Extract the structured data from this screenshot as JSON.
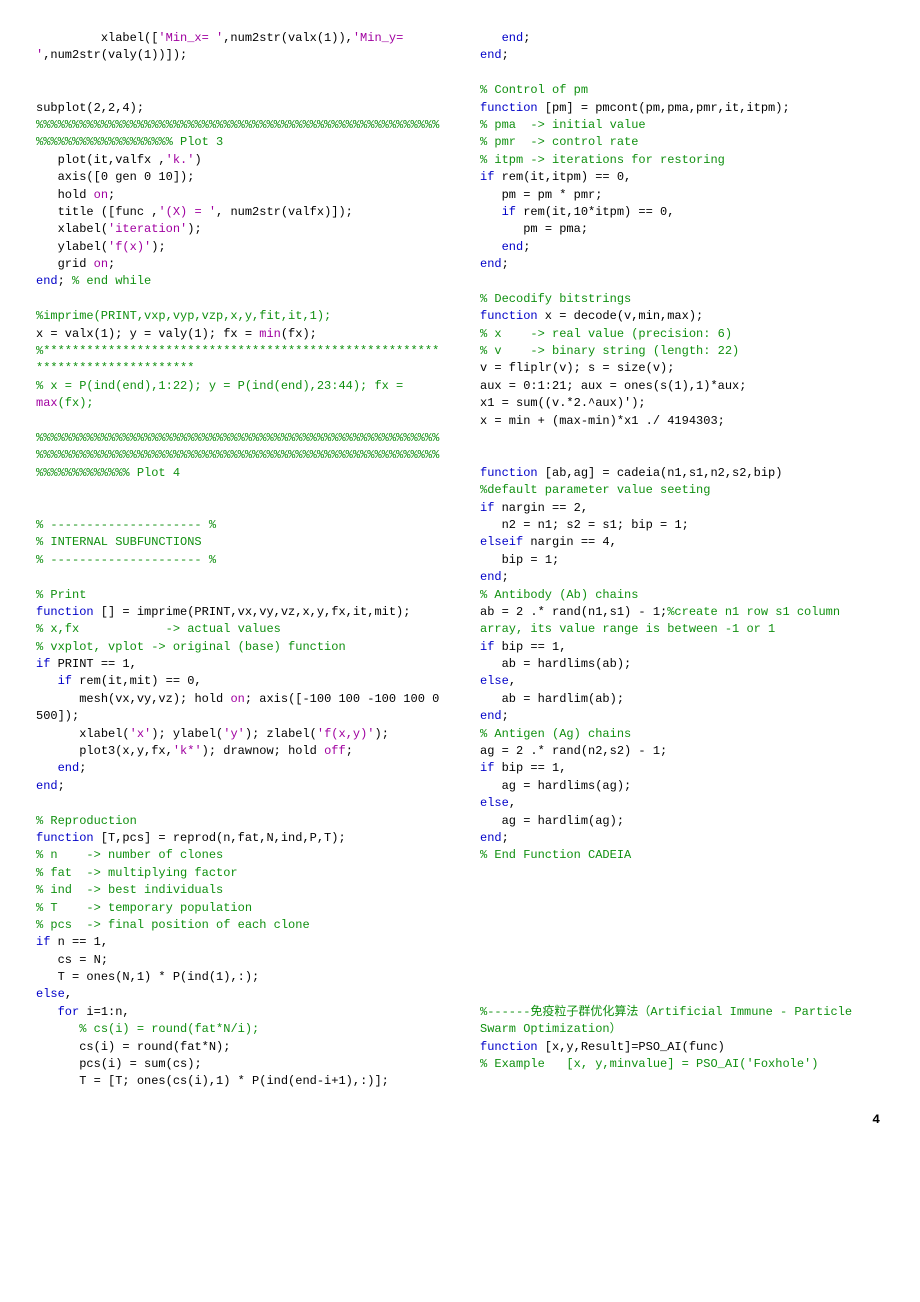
{
  "page_number": "4",
  "left": [
    {
      "indent": 3,
      "spans": [
        [
          "txt",
          "xlabel(["
        ],
        [
          "s",
          "'Min_x= '"
        ],
        [
          "txt",
          ",num2str(valx(1)),"
        ],
        [
          "s",
          "'Min_y= '"
        ],
        [
          "txt",
          ",num2str(valy(1))]);"
        ]
      ]
    },
    {
      "blank": true
    },
    {
      "blank": true
    },
    {
      "indent": 0,
      "spans": [
        [
          "txt",
          "subplot(2,2,4); "
        ],
        [
          "c",
          "%%%%%%%%%%%%%%%%%%%%%%%%%%%%%%%%%%%%%%%%%%%%%%%%%%%%%%%%%%%%%%%%%%%%%%%%%%% Plot 3"
        ]
      ]
    },
    {
      "indent": 1,
      "spans": [
        [
          "txt",
          "plot(it,valfx ,"
        ],
        [
          "s",
          "'k.'"
        ],
        [
          "txt",
          ")"
        ]
      ]
    },
    {
      "indent": 1,
      "spans": [
        [
          "txt",
          "axis([0 gen 0 10]);"
        ]
      ]
    },
    {
      "indent": 1,
      "spans": [
        [
          "txt",
          "hold "
        ],
        [
          "s",
          "on"
        ],
        [
          "txt",
          ";"
        ]
      ]
    },
    {
      "indent": 1,
      "spans": [
        [
          "txt",
          "title ([func ,"
        ],
        [
          "s",
          "'(X) = '"
        ],
        [
          "txt",
          ", num2str(valfx)]);"
        ]
      ]
    },
    {
      "indent": 1,
      "spans": [
        [
          "txt",
          "xlabel("
        ],
        [
          "s",
          "'iteration'"
        ],
        [
          "txt",
          ");"
        ]
      ]
    },
    {
      "indent": 1,
      "spans": [
        [
          "txt",
          "ylabel("
        ],
        [
          "s",
          "'f(x)'"
        ],
        [
          "txt",
          ");"
        ]
      ]
    },
    {
      "indent": 1,
      "spans": [
        [
          "txt",
          "grid "
        ],
        [
          "s",
          "on"
        ],
        [
          "txt",
          ";"
        ]
      ]
    },
    {
      "indent": 0,
      "spans": [
        [
          "k",
          "end"
        ],
        [
          "txt",
          "; "
        ],
        [
          "c",
          "% end while"
        ]
      ]
    },
    {
      "blank": true
    },
    {
      "indent": 0,
      "spans": [
        [
          "c",
          "%imprime(PRINT,vxp,vyp,vzp,x,y,fit,it,1);"
        ]
      ]
    },
    {
      "indent": 0,
      "spans": [
        [
          "txt",
          "x = valx(1); y = valy(1); fx = "
        ],
        [
          "s",
          "min"
        ],
        [
          "txt",
          "(fx); "
        ],
        [
          "c",
          "%*****************************************************************************"
        ]
      ]
    },
    {
      "indent": 0,
      "spans": [
        [
          "c",
          "% x = P(ind(end),1:22); y = P(ind(end),23:44); fx = "
        ],
        [
          "s",
          "max"
        ],
        [
          "c",
          "(fx);"
        ]
      ]
    },
    {
      "blank": true
    },
    {
      "indent": 0,
      "spans": [
        [
          "c",
          "%%%%%%%%%%%%%%%%%%%%%%%%%%%%%%%%%%%%%%%%%%%%%%%%%%%%%%%%%%%%%%%%%%%%%%%%%%%%%%%%%%%%%%%%%%%%%%%%%%%%%%%%%%%%%%%%%%%%%%%%%%%%% Plot 4"
        ]
      ]
    },
    {
      "blank": true
    },
    {
      "blank": true
    },
    {
      "indent": 0,
      "spans": [
        [
          "c",
          "% --------------------- %"
        ]
      ]
    },
    {
      "indent": 0,
      "spans": [
        [
          "c",
          "% INTERNAL SUBFUNCTIONS"
        ]
      ]
    },
    {
      "indent": 0,
      "spans": [
        [
          "c",
          "% --------------------- %"
        ]
      ]
    },
    {
      "blank": true
    },
    {
      "indent": 0,
      "spans": [
        [
          "c",
          "% Print"
        ]
      ]
    },
    {
      "indent": 0,
      "spans": [
        [
          "k",
          "function"
        ],
        [
          "txt",
          " [] = imprime(PRINT,vx,vy,vz,x,y,fx,it,mit);"
        ]
      ]
    },
    {
      "indent": 0,
      "spans": [
        [
          "c",
          "% x,fx            -> actual values"
        ]
      ]
    },
    {
      "indent": 0,
      "spans": [
        [
          "c",
          "% vxplot, vplot -> original (base) function"
        ]
      ]
    },
    {
      "indent": 0,
      "spans": [
        [
          "k",
          "if"
        ],
        [
          "txt",
          " PRINT == 1,"
        ]
      ]
    },
    {
      "indent": 1,
      "spans": [
        [
          "k",
          "if"
        ],
        [
          "txt",
          " rem(it,mit) == 0,"
        ]
      ]
    },
    {
      "indent": 2,
      "spans": [
        [
          "txt",
          "mesh(vx,vy,vz); hold "
        ],
        [
          "s",
          "on"
        ],
        [
          "txt",
          "; axis([-100 100 -100 100 0 500]);"
        ]
      ]
    },
    {
      "indent": 2,
      "spans": [
        [
          "txt",
          "xlabel("
        ],
        [
          "s",
          "'x'"
        ],
        [
          "txt",
          "); ylabel("
        ],
        [
          "s",
          "'y'"
        ],
        [
          "txt",
          "); zlabel("
        ],
        [
          "s",
          "'f(x,y)'"
        ],
        [
          "txt",
          ");"
        ]
      ]
    },
    {
      "indent": 2,
      "spans": [
        [
          "txt",
          "plot3(x,y,fx,"
        ],
        [
          "s",
          "'k*'"
        ],
        [
          "txt",
          "); drawnow; hold "
        ],
        [
          "s",
          "off"
        ],
        [
          "txt",
          ";"
        ]
      ]
    },
    {
      "indent": 1,
      "spans": [
        [
          "k",
          "end"
        ],
        [
          "txt",
          ";"
        ]
      ]
    },
    {
      "indent": 0,
      "spans": [
        [
          "k",
          "end"
        ],
        [
          "txt",
          ";"
        ]
      ]
    },
    {
      "blank": true
    },
    {
      "indent": 0,
      "spans": [
        [
          "c",
          "% Reproduction"
        ]
      ]
    },
    {
      "indent": 0,
      "spans": [
        [
          "k",
          "function"
        ],
        [
          "txt",
          " [T,pcs] = reprod(n,fat,N,ind,P,T);"
        ]
      ]
    },
    {
      "indent": 0,
      "spans": [
        [
          "c",
          "% n    -> number of clones"
        ]
      ]
    },
    {
      "indent": 0,
      "spans": [
        [
          "c",
          "% fat  -> multiplying factor"
        ]
      ]
    },
    {
      "indent": 0,
      "spans": [
        [
          "c",
          "% ind  -> best individuals"
        ]
      ]
    },
    {
      "indent": 0,
      "spans": [
        [
          "c",
          "% T    -> temporary population"
        ]
      ]
    },
    {
      "indent": 0,
      "spans": [
        [
          "c",
          "% pcs  -> final position of each clone"
        ]
      ]
    },
    {
      "indent": 0,
      "spans": [
        [
          "k",
          "if"
        ],
        [
          "txt",
          " n == 1,"
        ]
      ]
    },
    {
      "indent": 1,
      "spans": [
        [
          "txt",
          "cs = N;"
        ]
      ]
    },
    {
      "indent": 1,
      "spans": [
        [
          "txt",
          "T = ones(N,1) * P(ind(1),:);"
        ]
      ]
    },
    {
      "indent": 0,
      "spans": [
        [
          "k",
          "else"
        ],
        [
          "txt",
          ","
        ]
      ]
    },
    {
      "indent": 1,
      "spans": [
        [
          "k",
          "for"
        ],
        [
          "txt",
          " i=1:n,"
        ]
      ]
    },
    {
      "indent": 2,
      "spans": [
        [
          "c",
          "% cs(i) = round(fat*N/i);"
        ]
      ]
    },
    {
      "indent": 2,
      "spans": [
        [
          "txt",
          "cs(i) = round(fat*N);"
        ]
      ]
    },
    {
      "indent": 2,
      "spans": [
        [
          "txt",
          "pcs(i) = sum(cs);"
        ]
      ]
    },
    {
      "indent": 2,
      "spans": [
        [
          "txt",
          "T = [T; ones(cs(i),1) * P(ind(end-i+1),:)];"
        ]
      ]
    }
  ],
  "right": [
    {
      "indent": 1,
      "spans": [
        [
          "k",
          "end"
        ],
        [
          "txt",
          ";"
        ]
      ]
    },
    {
      "indent": 0,
      "spans": [
        [
          "k",
          "end"
        ],
        [
          "txt",
          ";"
        ]
      ]
    },
    {
      "blank": true
    },
    {
      "indent": 0,
      "spans": [
        [
          "c",
          "% Control of pm"
        ]
      ]
    },
    {
      "indent": 0,
      "spans": [
        [
          "k",
          "function"
        ],
        [
          "txt",
          " [pm] = pmcont(pm,pma,pmr,it,itpm);"
        ]
      ]
    },
    {
      "indent": 0,
      "spans": [
        [
          "c",
          "% pma  -> initial value"
        ]
      ]
    },
    {
      "indent": 0,
      "spans": [
        [
          "c",
          "% pmr  -> control rate"
        ]
      ]
    },
    {
      "indent": 0,
      "spans": [
        [
          "c",
          "% itpm -> iterations for restoring"
        ]
      ]
    },
    {
      "indent": 0,
      "spans": [
        [
          "k",
          "if"
        ],
        [
          "txt",
          " rem(it,itpm) == 0,"
        ]
      ]
    },
    {
      "indent": 1,
      "spans": [
        [
          "txt",
          "pm = pm * pmr;"
        ]
      ]
    },
    {
      "indent": 1,
      "spans": [
        [
          "k",
          "if"
        ],
        [
          "txt",
          " rem(it,10*itpm) == 0,"
        ]
      ]
    },
    {
      "indent": 2,
      "spans": [
        [
          "txt",
          "pm = pma;"
        ]
      ]
    },
    {
      "indent": 1,
      "spans": [
        [
          "k",
          "end"
        ],
        [
          "txt",
          ";"
        ]
      ]
    },
    {
      "indent": 0,
      "spans": [
        [
          "k",
          "end"
        ],
        [
          "txt",
          ";"
        ]
      ]
    },
    {
      "blank": true
    },
    {
      "indent": 0,
      "spans": [
        [
          "c",
          "% Decodify bitstrings"
        ]
      ]
    },
    {
      "indent": 0,
      "spans": [
        [
          "k",
          "function"
        ],
        [
          "txt",
          " x = decode(v,min,max);"
        ]
      ]
    },
    {
      "indent": 0,
      "spans": [
        [
          "c",
          "% x    -> real value (precision: 6)"
        ]
      ]
    },
    {
      "indent": 0,
      "spans": [
        [
          "c",
          "% v    -> binary string (length: 22)"
        ]
      ]
    },
    {
      "indent": 0,
      "spans": [
        [
          "txt",
          "v = fliplr(v); s = size(v);"
        ]
      ]
    },
    {
      "indent": 0,
      "spans": [
        [
          "txt",
          "aux = 0:1:21; aux = ones(s(1),1)*aux;"
        ]
      ]
    },
    {
      "indent": 0,
      "spans": [
        [
          "txt",
          "x1 = sum((v.*2.^aux)');"
        ]
      ]
    },
    {
      "indent": 0,
      "spans": [
        [
          "txt",
          "x = min + (max-min)*x1 ./ 4194303;"
        ]
      ]
    },
    {
      "blank": true
    },
    {
      "blank": true
    },
    {
      "indent": 0,
      "spans": [
        [
          "k",
          "function"
        ],
        [
          "txt",
          " [ab,ag] = cadeia(n1,s1,n2,s2,bip)"
        ]
      ]
    },
    {
      "indent": 0,
      "spans": [
        [
          "c",
          "%default parameter value seeting"
        ]
      ]
    },
    {
      "indent": 0,
      "spans": [
        [
          "k",
          "if"
        ],
        [
          "txt",
          " nargin == 2,"
        ]
      ]
    },
    {
      "indent": 1,
      "spans": [
        [
          "txt",
          "n2 = n1; s2 = s1; bip = 1;"
        ]
      ]
    },
    {
      "indent": 0,
      "spans": [
        [
          "k",
          "elseif"
        ],
        [
          "txt",
          " nargin == 4,"
        ]
      ]
    },
    {
      "indent": 1,
      "spans": [
        [
          "txt",
          "bip = 1;"
        ]
      ]
    },
    {
      "indent": 0,
      "spans": [
        [
          "k",
          "end"
        ],
        [
          "txt",
          ";"
        ]
      ]
    },
    {
      "indent": 0,
      "spans": [
        [
          "c",
          "% Antibody (Ab) chains"
        ]
      ]
    },
    {
      "indent": 0,
      "spans": [
        [
          "txt",
          "ab = 2 .* rand(n1,s1) - 1;"
        ],
        [
          "c",
          "%create n1 row s1 column array, its value range is between -1 or 1"
        ]
      ]
    },
    {
      "indent": 0,
      "spans": [
        [
          "k",
          "if"
        ],
        [
          "txt",
          " bip == 1,"
        ]
      ]
    },
    {
      "indent": 1,
      "spans": [
        [
          "txt",
          "ab = hardlims(ab);"
        ]
      ]
    },
    {
      "indent": 0,
      "spans": [
        [
          "k",
          "else"
        ],
        [
          "txt",
          ","
        ]
      ]
    },
    {
      "indent": 1,
      "spans": [
        [
          "txt",
          "ab = hardlim(ab);"
        ]
      ]
    },
    {
      "indent": 0,
      "spans": [
        [
          "k",
          "end"
        ],
        [
          "txt",
          ";"
        ]
      ]
    },
    {
      "indent": 0,
      "spans": [
        [
          "c",
          "% Antigen (Ag) chains"
        ]
      ]
    },
    {
      "indent": 0,
      "spans": [
        [
          "txt",
          "ag = 2 .* rand(n2,s2) - 1;"
        ]
      ]
    },
    {
      "indent": 0,
      "spans": [
        [
          "k",
          "if"
        ],
        [
          "txt",
          " bip == 1,"
        ]
      ]
    },
    {
      "indent": 1,
      "spans": [
        [
          "txt",
          "ag = hardlims(ag);"
        ]
      ]
    },
    {
      "indent": 0,
      "spans": [
        [
          "k",
          "else"
        ],
        [
          "txt",
          ","
        ]
      ]
    },
    {
      "indent": 1,
      "spans": [
        [
          "txt",
          "ag = hardlim(ag);"
        ]
      ]
    },
    {
      "indent": 0,
      "spans": [
        [
          "k",
          "end"
        ],
        [
          "txt",
          ";"
        ]
      ]
    },
    {
      "indent": 0,
      "spans": [
        [
          "c",
          "% End Function CADEIA"
        ]
      ]
    },
    {
      "blank": true
    },
    {
      "blank": true
    },
    {
      "blank": true
    },
    {
      "blank": true
    },
    {
      "blank": true
    },
    {
      "blank": true
    },
    {
      "blank": true
    },
    {
      "blank": true
    },
    {
      "indent": 0,
      "spans": [
        [
          "c",
          "%------免疫粒子群优化算法（Artificial Immune - Particle Swarm Optimization）"
        ]
      ]
    },
    {
      "indent": 0,
      "spans": [
        [
          "k",
          "function"
        ],
        [
          "txt",
          " [x,y,Result]=PSO_AI(func)"
        ]
      ]
    },
    {
      "indent": 0,
      "spans": [
        [
          "c",
          "% Example   [x, y,minvalue] = PSO_AI('Foxhole')"
        ]
      ]
    }
  ]
}
